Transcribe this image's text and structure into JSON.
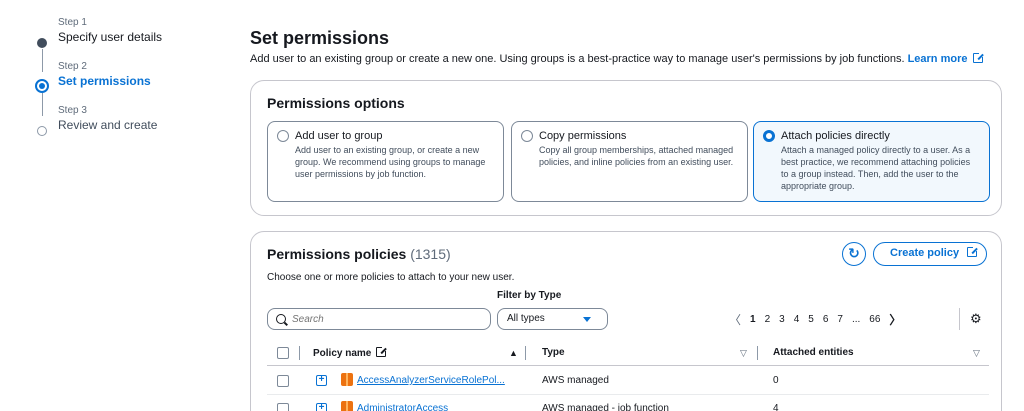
{
  "steps": [
    {
      "num": "Step 1",
      "label": "Specify user details"
    },
    {
      "num": "Step 2",
      "label": "Set permissions"
    },
    {
      "num": "Step 3",
      "label": "Review and create"
    }
  ],
  "page": {
    "title": "Set permissions",
    "subtitle": "Add user to an existing group or create a new one. Using groups is a best-practice way to manage user's permissions by job functions.",
    "learn_more": "Learn more"
  },
  "options_panel": {
    "title": "Permissions options",
    "options": [
      {
        "title": "Add user to group",
        "desc": "Add user to an existing group, or create a new group. We recommend using groups to manage user permissions by job function."
      },
      {
        "title": "Copy permissions",
        "desc": "Copy all group memberships, attached managed policies, and inline policies from an existing user."
      },
      {
        "title": "Attach policies directly",
        "desc": "Attach a managed policy directly to a user. As a best practice, we recommend attaching policies to a group instead. Then, add the user to the appropriate group."
      }
    ],
    "selected_index": 2
  },
  "policies_panel": {
    "title": "Permissions policies",
    "count": "(1315)",
    "description": "Choose one or more policies to attach to your new user.",
    "create_policy": "Create policy",
    "filter_label": "Filter by Type",
    "search_placeholder": "Search",
    "filter_value": "All types",
    "pagination": {
      "prev": "〈",
      "pages": [
        "1",
        "2",
        "3",
        "4",
        "5",
        "6",
        "7",
        "...",
        "66"
      ],
      "next": "〉",
      "current": "1"
    },
    "columns": {
      "name": "Policy name",
      "type": "Type",
      "entities": "Attached entities"
    },
    "rows": [
      {
        "name": "AccessAnalyzerServiceRolePol...",
        "type": "AWS managed",
        "entities": "0"
      },
      {
        "name": "AdministratorAccess",
        "type": "AWS managed - job function",
        "entities": "4"
      }
    ]
  },
  "colors": {
    "accent": "#0972d3",
    "border": "#c6c6cd",
    "text": "#16191f",
    "muted": "#5f6b7a",
    "selected_bg": "#f2f8fd"
  },
  "icons": {
    "external": "external-link-icon",
    "refresh": "refresh-icon",
    "search": "search-icon",
    "settings": "gear-icon",
    "caret": "caret-down-icon"
  }
}
